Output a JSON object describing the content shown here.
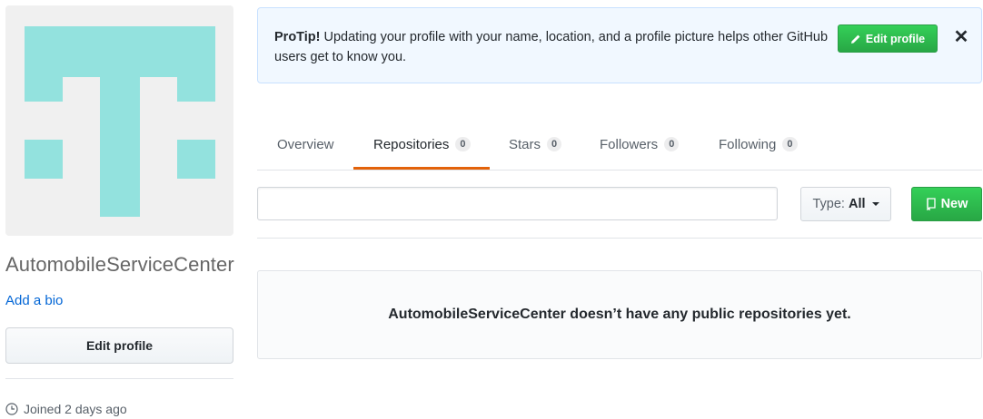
{
  "profile": {
    "username": "AutomobileServiceCenter",
    "add_bio_label": "Add a bio",
    "edit_profile_label": "Edit profile",
    "joined_text": "Joined 2 days ago",
    "avatar_color": "#93e2de",
    "avatar_bg": "#f0f0f0"
  },
  "protip": {
    "prefix": "ProTip!",
    "message": "Updating your profile with your name, location, and a profile picture helps other GitHub users get to know you.",
    "edit_button_label": "Edit profile",
    "close_label": "✕"
  },
  "tabs": [
    {
      "label": "Overview",
      "count": null,
      "selected": false
    },
    {
      "label": "Repositories",
      "count": "0",
      "selected": true
    },
    {
      "label": "Stars",
      "count": "0",
      "selected": false
    },
    {
      "label": "Followers",
      "count": "0",
      "selected": false
    },
    {
      "label": "Following",
      "count": "0",
      "selected": false
    }
  ],
  "filter": {
    "search_value": "",
    "type_label": "Type:",
    "type_value": "All",
    "new_button_label": "New"
  },
  "blankslate": {
    "message": "AutomobileServiceCenter doesn’t have any public repositories yet."
  },
  "colors": {
    "accent_green": "#28a745",
    "tab_underline": "#e36209",
    "link_blue": "#0366d6"
  }
}
